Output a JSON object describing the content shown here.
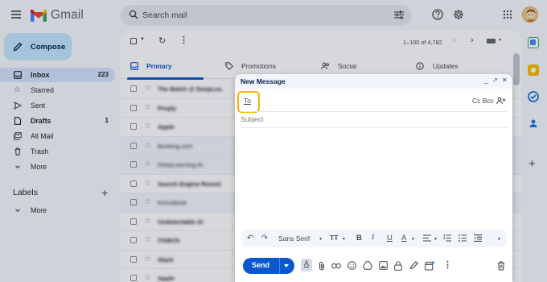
{
  "app": {
    "name": "Gmail"
  },
  "search": {
    "placeholder": "Search mail"
  },
  "compose_button": {
    "label": "Compose"
  },
  "sidebar": {
    "items": [
      {
        "label": "Inbox",
        "count": "223",
        "active": true
      },
      {
        "label": "Starred",
        "count": ""
      },
      {
        "label": "Sent",
        "count": ""
      },
      {
        "label": "Drafts",
        "count": "1"
      },
      {
        "label": "All Mail",
        "count": ""
      },
      {
        "label": "Trash",
        "count": ""
      },
      {
        "label": "More",
        "count": ""
      }
    ],
    "labels_title": "Labels",
    "labels_more": "More"
  },
  "mail_toolbar": {
    "pagination": "1–100 of 4,782"
  },
  "tabs": [
    {
      "label": "Primary",
      "active": true
    },
    {
      "label": "Promotions"
    },
    {
      "label": "Social"
    },
    {
      "label": "Updates"
    }
  ],
  "emails": [
    {
      "sender": "The Batch @ DeepLea.",
      "read": false
    },
    {
      "sender": "Preply",
      "read": false
    },
    {
      "sender": "Apple",
      "read": false
    },
    {
      "sender": "Booking.com",
      "read": true
    },
    {
      "sender": "DeepLearning.AI",
      "read": true
    },
    {
      "sender": "Search Engine Round.",
      "read": false
    },
    {
      "sender": "Komubook",
      "read": true
    },
    {
      "sender": "Undetectable AI",
      "read": false
    },
    {
      "sender": "ITABUS",
      "read": false
    },
    {
      "sender": "Slack",
      "read": false
    },
    {
      "sender": "Apple",
      "read": false
    }
  ],
  "compose_window": {
    "title": "New Message",
    "controls": {
      "minimize": "_",
      "expand": "↗",
      "close": "✕"
    },
    "to_label": "To",
    "cc_bcc": "Cc Bcc",
    "subject_placeholder": "Subject",
    "formatting": {
      "font_name": "Sans Serif",
      "undo": "↶",
      "redo": "↷",
      "text_size": "TT",
      "bold": "B",
      "italic": "I",
      "underline": "U",
      "text_color": "A"
    },
    "send_label": "Send"
  },
  "colors": {
    "accent": "#0b57d0",
    "compose_bg": "#c2e7ff",
    "active_nav": "#d3e3fd",
    "highlight": "#f4b400"
  }
}
